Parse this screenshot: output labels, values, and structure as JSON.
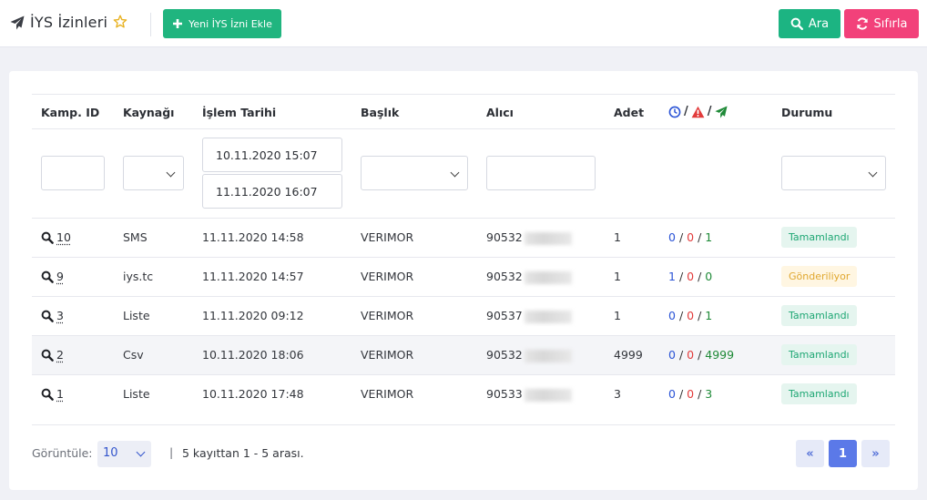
{
  "header": {
    "title": "İYS İzinleri",
    "add_button_label": "Yeni İYS İzni Ekle",
    "search_button_label": "Ara",
    "reset_button_label": "Sıfırla",
    "icons": [
      "paper-plane-icon",
      "star-icon",
      "plus-icon",
      "search-icon",
      "refresh-icon"
    ]
  },
  "table": {
    "columns": [
      "Kamp. ID",
      "Kaynağı",
      "İşlem Tarihi",
      "Başlık",
      "Alıcı",
      "Adet",
      "",
      "Durumu"
    ],
    "status_column_icons": [
      "clock-icon",
      "warning-icon",
      "paper-plane-icon"
    ],
    "status_column_separator": "/",
    "filters": {
      "campaign_id": "",
      "source": "",
      "date_start": "10.11.2020 15:07",
      "date_end": "11.11.2020 16:07",
      "title": "",
      "recipient": "",
      "status": ""
    },
    "rows": [
      {
        "id": "10",
        "source": "SMS",
        "date": "11.11.2020 14:58",
        "title": "VERIMOR",
        "recipient": "90532",
        "count": "1",
        "waiting": "0",
        "failed": "0",
        "sent": "1",
        "status": "Tamamlandı",
        "status_type": "done"
      },
      {
        "id": "9",
        "source": "iys.tc",
        "date": "11.11.2020 14:57",
        "title": "VERIMOR",
        "recipient": "90532",
        "count": "1",
        "waiting": "1",
        "failed": "0",
        "sent": "0",
        "status": "Gönderiliyor",
        "status_type": "sending"
      },
      {
        "id": "3",
        "source": "Liste",
        "date": "11.11.2020 09:12",
        "title": "VERIMOR",
        "recipient": "90537",
        "count": "1",
        "waiting": "0",
        "failed": "0",
        "sent": "1",
        "status": "Tamamlandı",
        "status_type": "done"
      },
      {
        "id": "2",
        "source": "Csv",
        "date": "10.11.2020 18:06",
        "title": "VERIMOR",
        "recipient": "90532",
        "count": "4999",
        "waiting": "0",
        "failed": "0",
        "sent": "4999",
        "status": "Tamamlandı",
        "status_type": "done"
      },
      {
        "id": "1",
        "source": "Liste",
        "date": "10.11.2020 17:48",
        "title": "VERIMOR",
        "recipient": "90533",
        "count": "3",
        "waiting": "0",
        "failed": "0",
        "sent": "3",
        "status": "Tamamlandı",
        "status_type": "done"
      }
    ]
  },
  "footer": {
    "page_size_label": "Görüntüle:",
    "page_size": "10",
    "separator": "|",
    "info": "5 kayıttan 1 - 5 arası.",
    "prev_label": "«",
    "current_page": "1",
    "next_label": "»"
  },
  "colors": {
    "green": "#20b57f",
    "pink": "#f2417a",
    "blue": "#2b54d6",
    "red": "#e23b3b",
    "sent_green": "#1f8a38",
    "pagination": "#5b79e8"
  }
}
